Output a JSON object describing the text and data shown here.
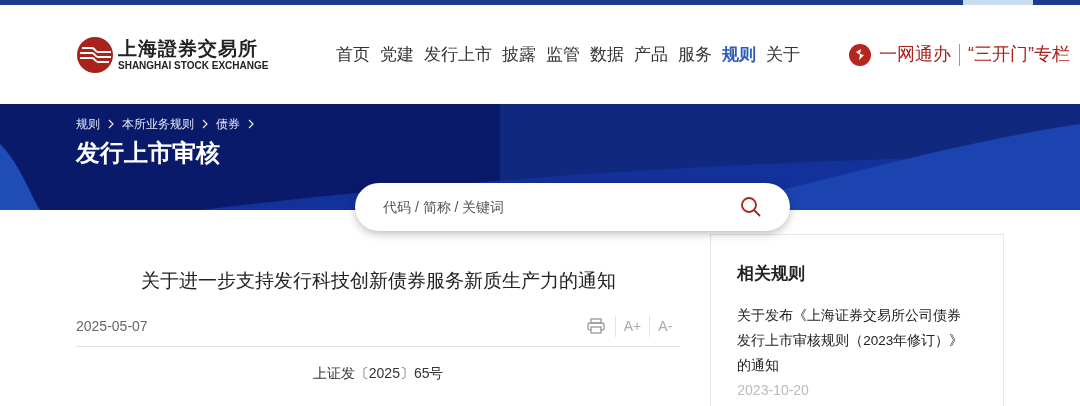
{
  "logo": {
    "name_cn": "上海證券交易所",
    "name_en": "SHANGHAI STOCK EXCHANGE"
  },
  "nav": [
    {
      "label": "首页",
      "selected": false
    },
    {
      "label": "党建",
      "selected": false
    },
    {
      "label": "发行上市",
      "selected": false
    },
    {
      "label": "披露",
      "selected": false
    },
    {
      "label": "监管",
      "selected": false
    },
    {
      "label": "数据",
      "selected": false
    },
    {
      "label": "产品",
      "selected": false
    },
    {
      "label": "服务",
      "selected": false
    },
    {
      "label": "规则",
      "selected": true
    },
    {
      "label": "关于",
      "selected": false
    }
  ],
  "quick_links": [
    "一网通办",
    "“三开门”专栏"
  ],
  "breadcrumb": [
    "规则",
    "本所业务规则",
    "债券"
  ],
  "page_title": "发行上市审核",
  "search": {
    "placeholder": "代码 / 简称 / 关键词"
  },
  "article": {
    "title": "关于进一步支持发行科技创新债券服务新质生产力的通知",
    "date": "2025-05-07",
    "font_buttons": [
      "A+",
      "A-"
    ],
    "doc_number": "上证发〔2025〕65号"
  },
  "related": {
    "heading": "相关规则",
    "items": [
      {
        "title": "关于发布《上海证券交易所公司债券发行上市审核规则（2023年修订）》的通知",
        "date": "2023-10-20"
      }
    ]
  }
}
